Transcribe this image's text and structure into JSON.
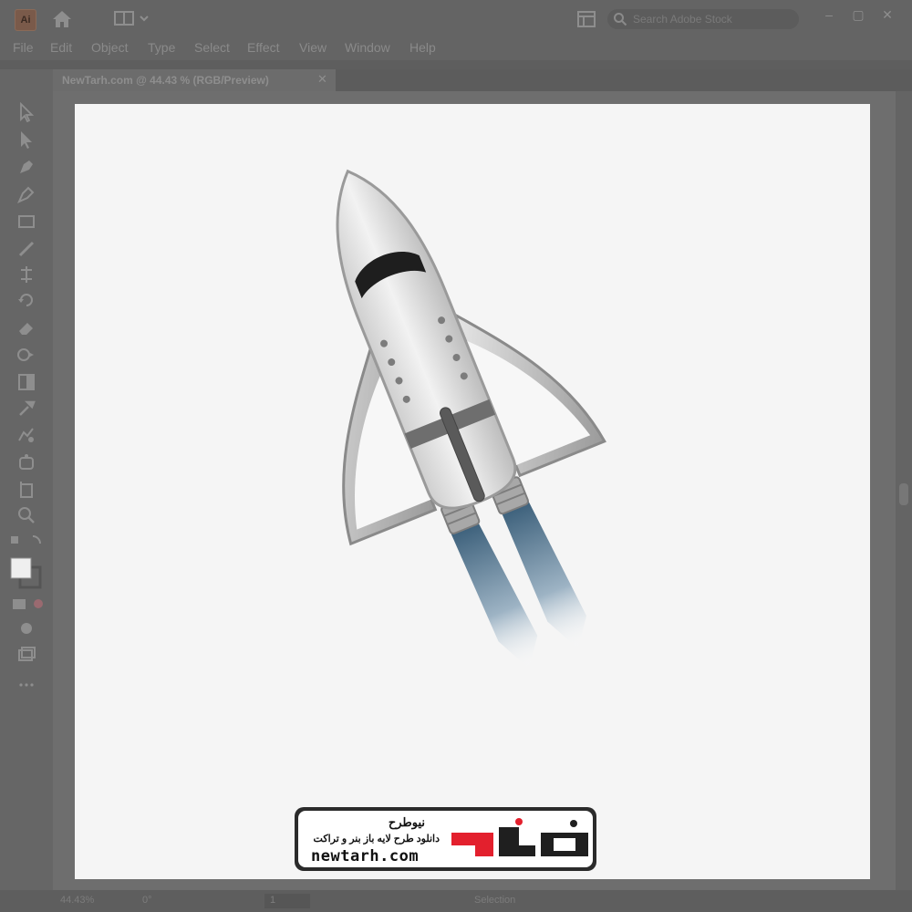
{
  "window": {
    "app_icon_letter": "Ai",
    "search_placeholder": "Search Adobe Stock",
    "controls": {
      "minimize": "–",
      "maximize": "▢",
      "close": "✕"
    }
  },
  "menu": [
    "File",
    "Edit",
    "Object",
    "Type",
    "Select",
    "Effect",
    "View",
    "Window",
    "Help"
  ],
  "document_tab": {
    "title": "NewTarh.com @ 44.43 % (RGB/Preview)",
    "close": "✕"
  },
  "status": {
    "zoom": "44.43%",
    "rotation": "0°",
    "artboard": "1",
    "mode": "Selection"
  },
  "watermark": {
    "name": "نیوطرح",
    "tagline": "دانلود طرح لایه باز بنر و تراکت",
    "url": "newtarh.com",
    "brand_color": "#e3202d"
  },
  "tools": [
    "selection-icon",
    "direct-selection-icon",
    "pen-icon",
    "curvature-icon",
    "rectangle-icon",
    "brush-icon",
    "width-icon",
    "rotate-icon",
    "eraser-icon",
    "shape-builder-icon",
    "gradient-icon",
    "eyedropper-icon",
    "blend-icon",
    "symbol-sprayer-icon",
    "artboard-icon",
    "zoom-icon",
    "swap-colors-icon",
    "fill-stroke-icon",
    "draw-mode-icon",
    "screen-mode-icon",
    "edit-toolbar-icon"
  ]
}
